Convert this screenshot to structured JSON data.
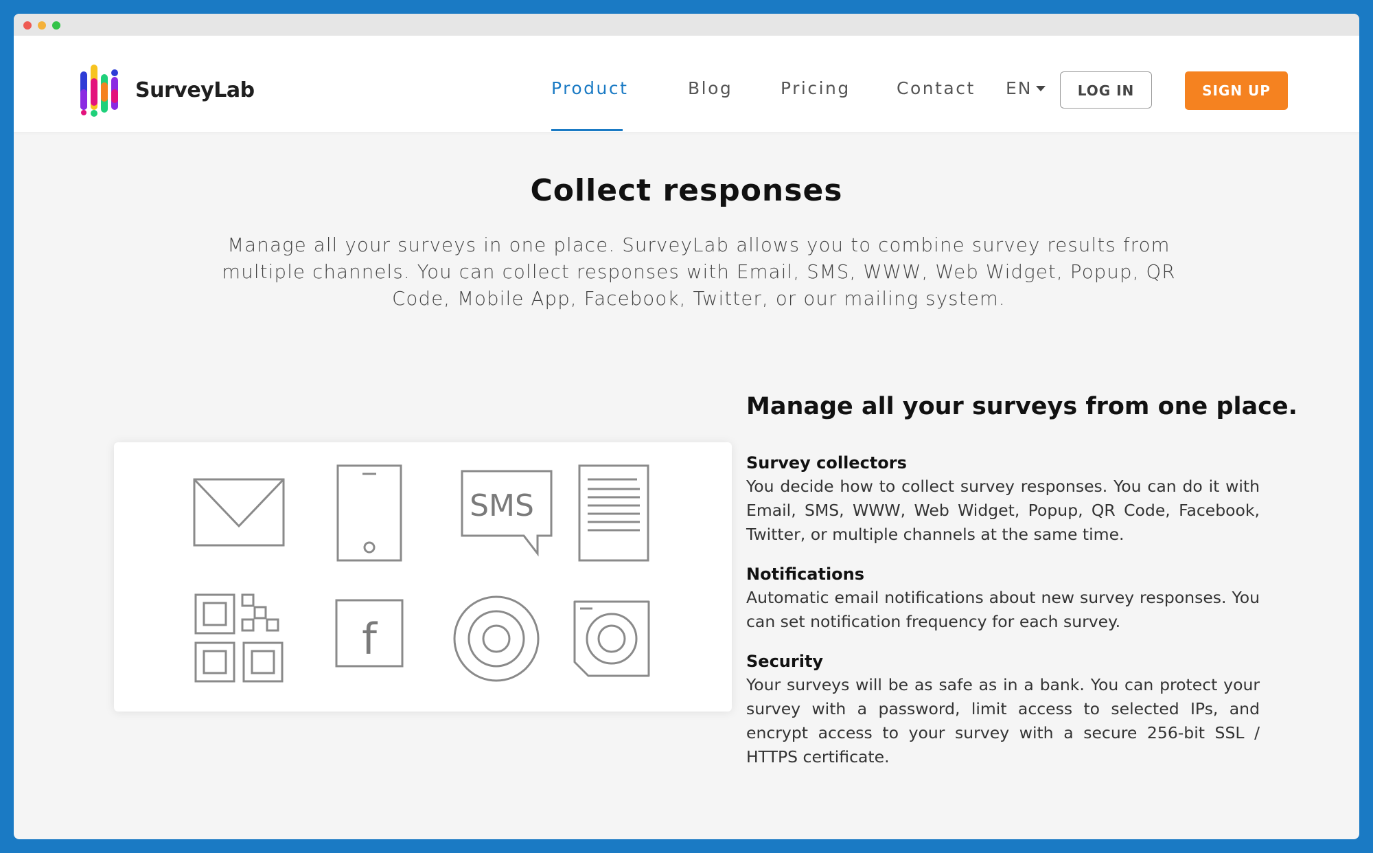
{
  "window": {
    "controls": [
      "close",
      "minimize",
      "maximize"
    ]
  },
  "brand": {
    "name": "SurveyLab",
    "logo_colors": [
      "#2d3cd6",
      "#e3127c",
      "#f7c320",
      "#1fd07a",
      "#8a2be2",
      "#f58220"
    ]
  },
  "nav": {
    "items": [
      {
        "label": "Product",
        "active": true
      },
      {
        "label": "Blog",
        "active": false
      },
      {
        "label": "Pricing",
        "active": false
      },
      {
        "label": "Contact",
        "active": false
      }
    ],
    "language": "EN",
    "login_label": "LOG IN",
    "signup_label": "SIGN UP"
  },
  "hero": {
    "title": "Collect responses",
    "description": "Manage all your surveys in one place. SurveyLab allows you to combine survey results from multiple channels. You can collect responses with Email, SMS, WWW, Web Widget, Popup, QR Code, Mobile App, Facebook, Twitter, or our mailing system."
  },
  "channels_card": {
    "icons": [
      "email-icon",
      "mobile-icon",
      "sms-icon",
      "document-icon",
      "qr-code-icon",
      "facebook-icon",
      "target-icon",
      "widget-icon"
    ],
    "sms_text": "SMS",
    "facebook_text": "f"
  },
  "features": {
    "title": "Manage all your surveys from one place.",
    "sections": [
      {
        "heading": "Survey collectors",
        "text": "You decide how to collect survey responses. You can do it with Email, SMS, WWW, Web Widget, Popup, QR Code, Facebook, Twitter, or multiple channels at the same time."
      },
      {
        "heading": "Notifications",
        "text": "Automatic email notifications about new survey responses. You can set notification frequency for each survey."
      },
      {
        "heading": "Security",
        "text": "Your surveys will be as safe as in a bank. You can protect your sur­vey with a password, limit access to selected IPs, and encrypt ac­cess to your survey with a secure 256-bit SSL / HTTPS certificate."
      }
    ]
  },
  "colors": {
    "accent": "#1a7ac4",
    "signup": "#f58220",
    "frame": "#1a7ac4"
  }
}
